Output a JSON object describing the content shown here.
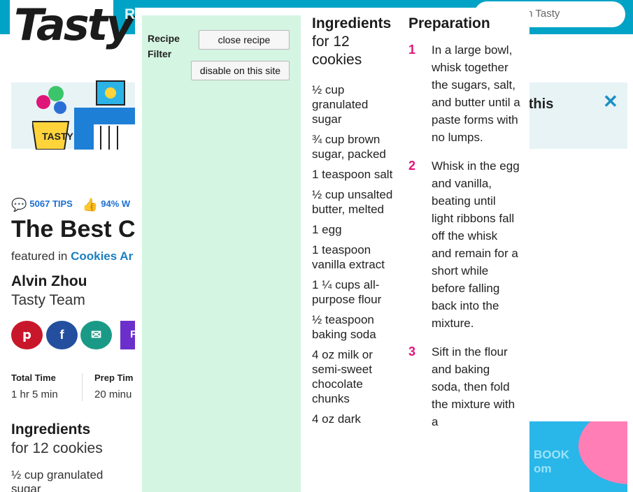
{
  "header": {
    "logo": "Tasty",
    "nav_stub": "R",
    "search_placeholder": "Search Tasty"
  },
  "banner": {
    "text": "n this",
    "close_glyph": "✕"
  },
  "recipe": {
    "tips": "5067 TIPS",
    "rating": "94% W",
    "title": "The Best C",
    "featured_prefix": "featured in",
    "featured_link": "Cookies Ar",
    "author": "Alvin Zhou",
    "team": "Tasty Team",
    "purple_button_stub": "F",
    "total_time_label": "Total Time",
    "total_time_value": "1 hr 5 min",
    "prep_time_label": "Prep Tim",
    "prep_time_value": "20 minu",
    "ingredients_heading": "Ingredients",
    "ingredients_sub": "for 12 cookies",
    "first_ingredient": "½ cup granulated sugar"
  },
  "ad": {
    "text_line1": "BOOK",
    "text_line2": "om"
  },
  "filter": {
    "title": "Recipe Filter",
    "close_button": "close recipe",
    "disable_button": "disable on this site"
  },
  "popup": {
    "ingredients_heading": "Ingredients",
    "ingredients_sub": "for 12 cookies",
    "ingredients": [
      "½ cup granulated sugar",
      "¾ cup brown sugar, packed",
      "1 teaspoon salt",
      "½ cup unsalted butter, melted",
      "1 egg",
      "1 teaspoon vanilla extract",
      "1 ¼ cups all-purpose flour",
      "½ teaspoon baking soda",
      "4 oz milk or semi-sweet chocolate chunks",
      "4 oz dark"
    ],
    "preparation_heading": "Preparation",
    "steps": [
      {
        "num": "1",
        "text": "In a large bowl, whisk together the sugars, salt, and butter until a paste forms with no lumps."
      },
      {
        "num": "2",
        "text": "Whisk in the egg and vanilla, beating until light ribbons fall off the whisk and remain for a short while before falling back into the mixture."
      },
      {
        "num": "3",
        "text": "Sift in the flour and baking soda, then fold the mixture with a"
      }
    ]
  }
}
